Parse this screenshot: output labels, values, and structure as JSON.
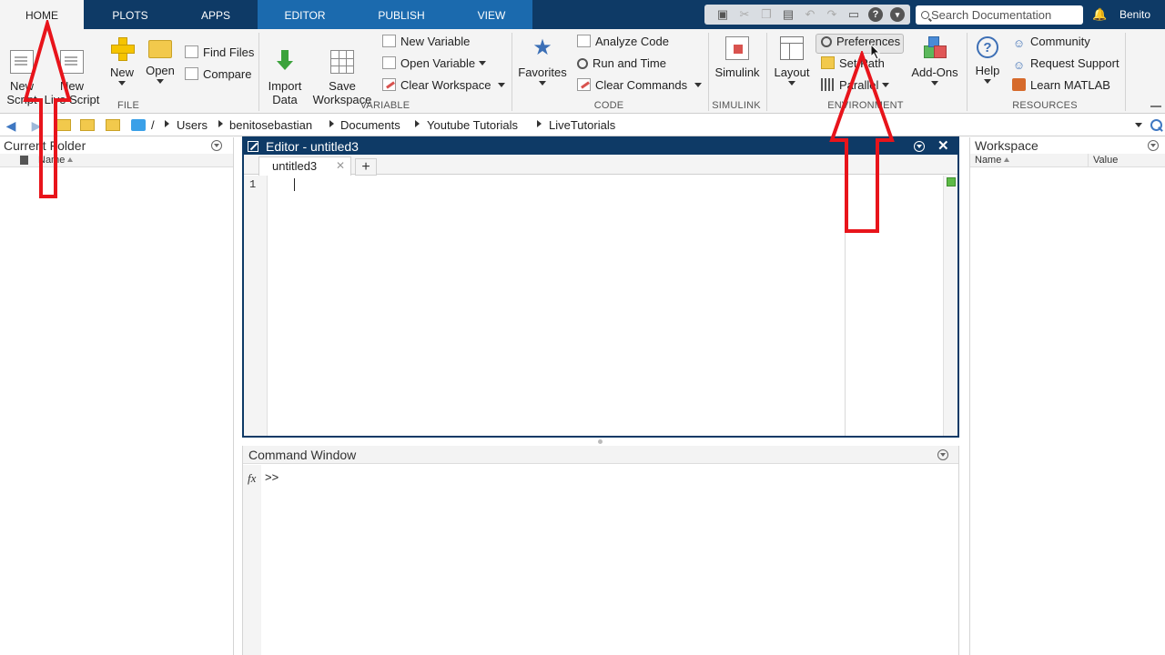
{
  "tabs": [
    {
      "id": "home",
      "label": "HOME",
      "active": true
    },
    {
      "id": "plots",
      "label": "PLOTS"
    },
    {
      "id": "apps",
      "label": "APPS"
    },
    {
      "id": "editor",
      "label": "EDITOR"
    },
    {
      "id": "publish",
      "label": "PUBLISH"
    },
    {
      "id": "view",
      "label": "VIEW"
    }
  ],
  "search": {
    "placeholder": "Search Documentation"
  },
  "user": {
    "name": "Benito"
  },
  "ribbon": {
    "file": {
      "label": "FILE",
      "new_script": "New\nScript",
      "new_live_script": "New\nLive Script",
      "new": "New",
      "open": "Open",
      "find_files": "Find Files",
      "compare": "Compare"
    },
    "variable": {
      "label": "VARIABLE",
      "import_data": "Import\nData",
      "save_workspace": "Save\nWorkspace",
      "new_variable": "New Variable",
      "open_variable": "Open Variable",
      "clear_workspace": "Clear Workspace"
    },
    "code": {
      "label": "CODE",
      "favorites": "Favorites",
      "analyze_code": "Analyze Code",
      "run_and_time": "Run and Time",
      "clear_commands": "Clear Commands"
    },
    "simulink": {
      "label": "SIMULINK",
      "simulink": "Simulink"
    },
    "environment": {
      "label": "ENVIRONMENT",
      "layout": "Layout",
      "preferences": "Preferences",
      "set_path": "Set Path",
      "parallel": "Parallel",
      "add_ons": "Add-Ons"
    },
    "resources": {
      "label": "RESOURCES",
      "help": "Help",
      "community": "Community",
      "request_support": "Request Support",
      "learn_matlab": "Learn MATLAB"
    }
  },
  "path": {
    "root": "/",
    "segments": [
      "Users",
      "benitosebastian",
      "Documents",
      "Youtube Tutorials",
      "LiveTutorials"
    ]
  },
  "current_folder": {
    "title": "Current Folder",
    "column_name": "Name"
  },
  "editor": {
    "title": "Editor - untitled3",
    "tab_label": "untitled3",
    "close_glyph": "✕",
    "new_tab_glyph": "+",
    "line_number": "1"
  },
  "command_window": {
    "title": "Command Window",
    "fx": "fx",
    "prompt": ">>"
  },
  "workspace": {
    "title": "Workspace",
    "column_name": "Name",
    "column_value": "Value"
  },
  "colors": {
    "tab_bar": "#0e3a66",
    "editor_group": "#1b6aae",
    "annotation_arrow": "#e8141b"
  }
}
